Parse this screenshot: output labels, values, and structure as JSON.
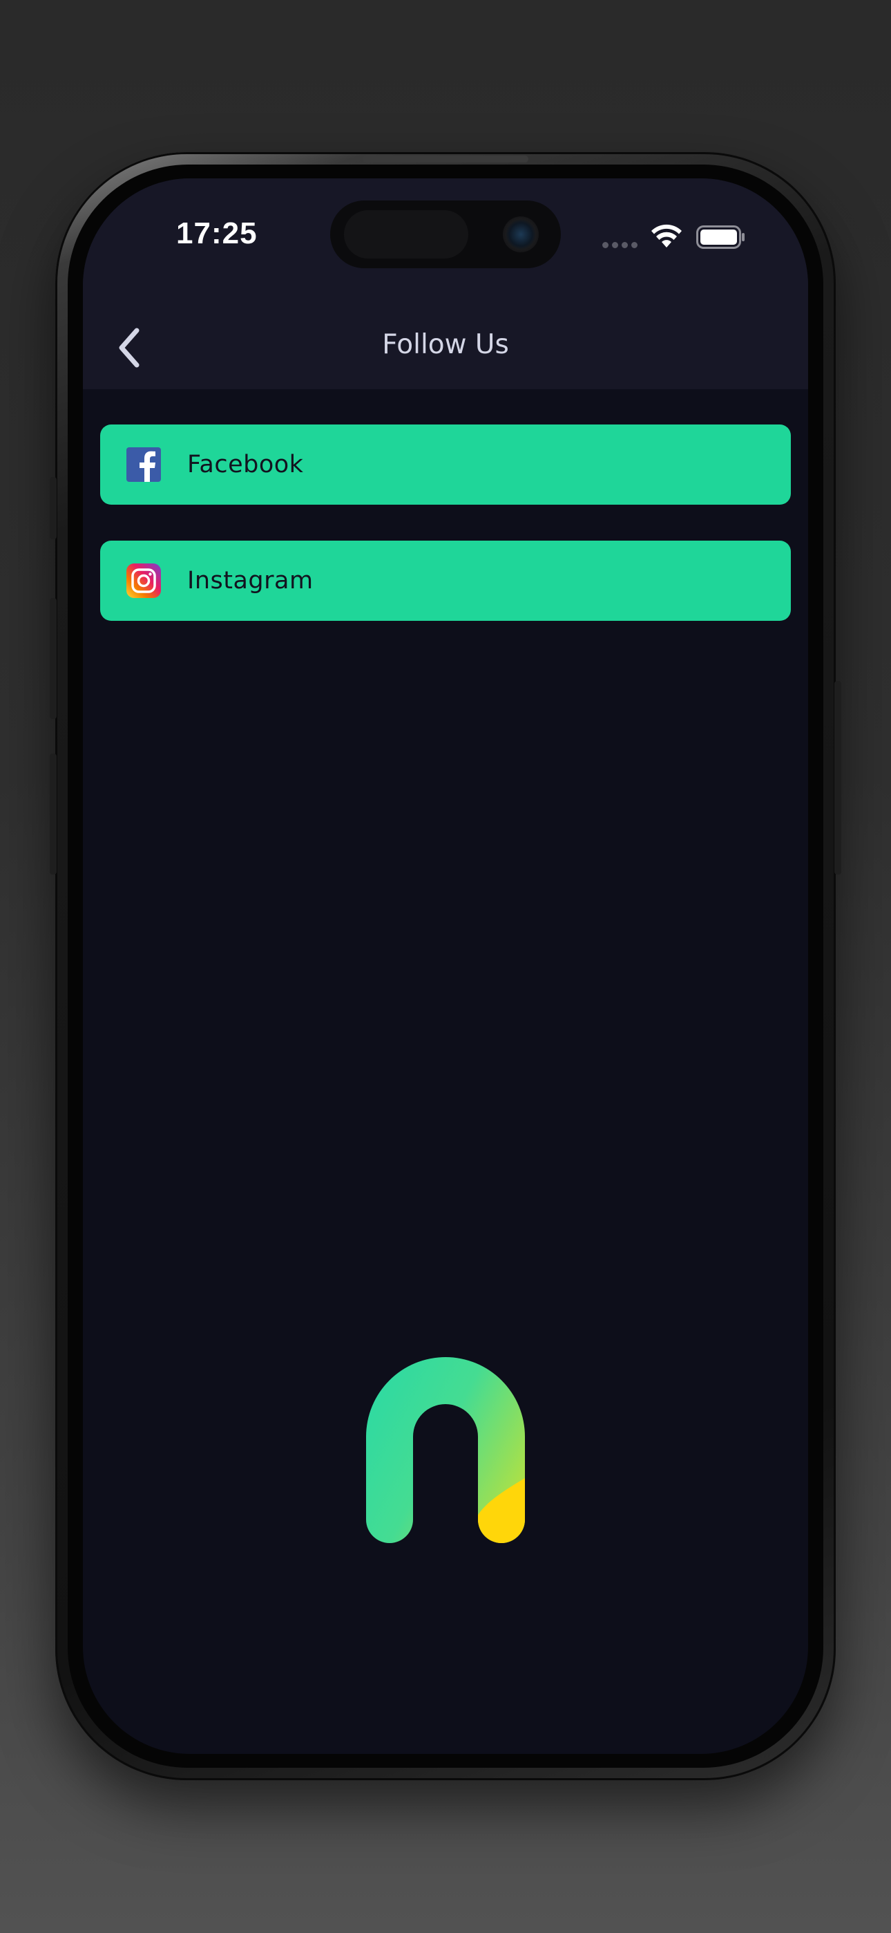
{
  "status_bar": {
    "time": "17:25"
  },
  "header": {
    "title": "Follow Us"
  },
  "social_links": [
    {
      "label": "Facebook",
      "icon": "facebook-icon"
    },
    {
      "label": "Instagram",
      "icon": "instagram-icon"
    }
  ],
  "colors": {
    "accent": "#1fd699",
    "header_bg": "#171726",
    "screen_bg": "#0d0e1a",
    "title_text": "#d4d6e6",
    "button_text": "#12131f"
  },
  "brand_logo": "app-logo-n-icon"
}
